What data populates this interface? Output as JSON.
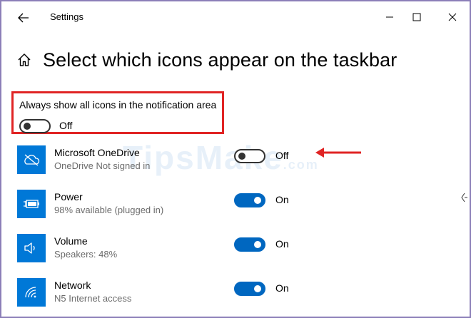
{
  "window": {
    "title": "Settings"
  },
  "page": {
    "title": "Select which icons appear on the taskbar"
  },
  "always_show": {
    "label": "Always show all icons in the notification area",
    "state_label": "Off",
    "enabled": false
  },
  "items": [
    {
      "name": "Microsoft OneDrive",
      "status": "OneDrive Not signed in",
      "state_label": "Off",
      "enabled": false,
      "icon": "onedrive-icon"
    },
    {
      "name": "Power",
      "status": "98% available (plugged in)",
      "state_label": "On",
      "enabled": true,
      "icon": "battery-icon"
    },
    {
      "name": "Volume",
      "status": "Speakers: 48%",
      "state_label": "On",
      "enabled": true,
      "icon": "speaker-icon"
    },
    {
      "name": "Network",
      "status": "N5 Internet access",
      "state_label": "On",
      "enabled": true,
      "icon": "wifi-icon"
    }
  ],
  "watermark": {
    "text": "TipsMake",
    "suffix": ".com"
  },
  "colors": {
    "accent": "#0067c0",
    "tile": "#0078d7",
    "highlight": "#e02424",
    "frame": "#8c7fb8"
  }
}
